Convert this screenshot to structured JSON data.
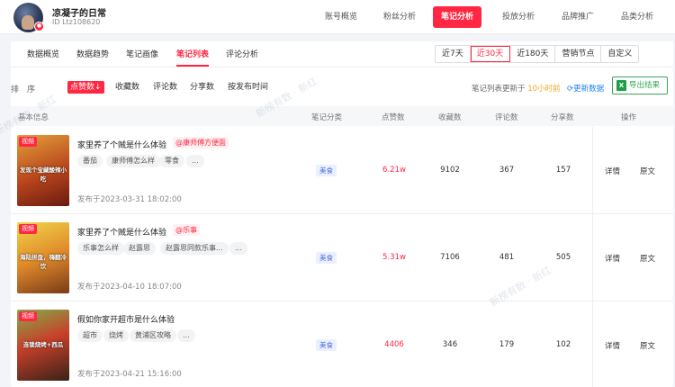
{
  "user": {
    "name": "凉凝子的日常",
    "id_text": "ID Ltz108620"
  },
  "top_nav": [
    {
      "label": "账号概览",
      "active": false
    },
    {
      "label": "粉丝分析",
      "active": false
    },
    {
      "label": "笔记分析",
      "active": true
    },
    {
      "label": "投放分析",
      "active": false
    },
    {
      "label": "品牌推广",
      "active": false
    },
    {
      "label": "品类分析",
      "active": false
    }
  ],
  "sub_tabs": [
    {
      "label": "数据概览"
    },
    {
      "label": "数据趋势"
    },
    {
      "label": "笔记画像"
    },
    {
      "label": "笔记列表"
    },
    {
      "label": "评论分析"
    }
  ],
  "ranges": [
    {
      "label": "近7天"
    },
    {
      "label": "近30天"
    },
    {
      "label": "近180天"
    },
    {
      "label": "营销节点"
    },
    {
      "label": "自定义"
    }
  ],
  "sort": {
    "label": "排　序",
    "items": [
      {
        "label": "点赞数↓"
      },
      {
        "label": "收藏数"
      },
      {
        "label": "评论数"
      },
      {
        "label": "分享数"
      },
      {
        "label": "按发布时间"
      }
    ]
  },
  "update": {
    "prefix": "笔记列表更新于",
    "time": "10小时前",
    "refresh": "更新数据",
    "export": "导出结果"
  },
  "table_headers": [
    "基本信息",
    "笔记分类",
    "点赞数",
    "收藏数",
    "评论数",
    "分享数",
    "操作"
  ],
  "rows": [
    {
      "thumb_tag": "视频",
      "thumb_caption": "发现个宝藏酸辣小吃",
      "title": "家里养了个贼是什么体验",
      "mention": "@康师傅方便面",
      "tags": [
        "番茄",
        "康师傅怎么样",
        "零食",
        "..."
      ],
      "date": "发布于2023-03-31 18:02:00",
      "category": "美食",
      "likes": "6.21w",
      "favorites": "9102",
      "comments": "367",
      "shares": "157",
      "op_detail": "详情",
      "op_original": "原文"
    },
    {
      "thumb_tag": "视频",
      "thumb_caption": "海陆拼盘，嗨翻冷饮",
      "title": "家里养了个贼是什么体验",
      "mention": "@乐事",
      "tags": [
        "乐事怎么样",
        "赵露思",
        "赵露思同款乐事...",
        "..."
      ],
      "date": "发布于2023-04-10 18:07:00",
      "category": "美食",
      "likes": "5.31w",
      "favorites": "7106",
      "comments": "481",
      "shares": "505",
      "op_detail": "详情",
      "op_original": "原文"
    },
    {
      "thumb_tag": "视频",
      "thumb_caption": "连锁烧烤+西瓜",
      "title": "假如你家开超市是什么体验",
      "mention": "",
      "tags": [
        "超市",
        "烧烤",
        "黄浦区攻略",
        "..."
      ],
      "date": "发布于2023-04-21 15:16:00",
      "category": "美食",
      "likes": "4406",
      "favorites": "346",
      "comments": "179",
      "shares": "102",
      "op_detail": "详情",
      "op_original": "原文"
    }
  ],
  "watermark": "新榜有数 · 新红"
}
